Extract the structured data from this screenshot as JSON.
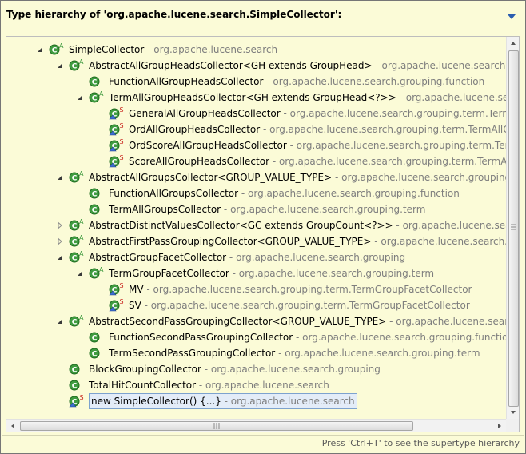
{
  "header": {
    "title": "Type hierarchy of 'org.apache.lucene.search.SimpleCollector':",
    "menu_icon": "triangle-down-icon"
  },
  "tree": {
    "rows": [
      {
        "name": "SimpleCollector",
        "qual": " - org.apache.lucene.search",
        "level": 0,
        "twisty": "expanded",
        "icon": "class-abstract"
      },
      {
        "name": "AbstractAllGroupHeadsCollector<GH extends GroupHead>",
        "qual": " - org.apache.lucene.search.grouping",
        "level": 1,
        "twisty": "expanded",
        "icon": "class-abstract"
      },
      {
        "name": "FunctionAllGroupHeadsCollector",
        "qual": " - org.apache.lucene.search.grouping.function",
        "level": 2,
        "twisty": "none",
        "icon": "class"
      },
      {
        "name": "TermAllGroupHeadsCollector<GH extends GroupHead<?>>",
        "qual": " - org.apache.lucene.search.grouping.term",
        "level": 2,
        "twisty": "expanded",
        "icon": "class-abstract"
      },
      {
        "name": "GeneralAllGroupHeadsCollector",
        "qual": " - org.apache.lucene.search.grouping.term.TermAllGroupHeadsCollector",
        "level": 3,
        "twisty": "none",
        "icon": "class-static-inner"
      },
      {
        "name": "OrdAllGroupHeadsCollector",
        "qual": " - org.apache.lucene.search.grouping.term.TermAllGroupHeadsCollector",
        "level": 3,
        "twisty": "none",
        "icon": "class-static-inner"
      },
      {
        "name": "OrdScoreAllGroupHeadsCollector",
        "qual": " - org.apache.lucene.search.grouping.term.TermAllGroupHeadsCollector",
        "level": 3,
        "twisty": "none",
        "icon": "class-static-inner"
      },
      {
        "name": "ScoreAllGroupHeadsCollector",
        "qual": " - org.apache.lucene.search.grouping.term.TermAllGroupHeadsCollector",
        "level": 3,
        "twisty": "none",
        "icon": "class-static-inner"
      },
      {
        "name": "AbstractAllGroupsCollector<GROUP_VALUE_TYPE>",
        "qual": " - org.apache.lucene.search.grouping",
        "level": 1,
        "twisty": "expanded",
        "icon": "class-abstract"
      },
      {
        "name": "FunctionAllGroupsCollector",
        "qual": " - org.apache.lucene.search.grouping.function",
        "level": 2,
        "twisty": "none",
        "icon": "class"
      },
      {
        "name": "TermAllGroupsCollector",
        "qual": " - org.apache.lucene.search.grouping.term",
        "level": 2,
        "twisty": "none",
        "icon": "class"
      },
      {
        "name": "AbstractDistinctValuesCollector<GC extends GroupCount<?>>",
        "qual": " - org.apache.lucene.search.grouping",
        "level": 1,
        "twisty": "collapsed",
        "icon": "class-abstract"
      },
      {
        "name": "AbstractFirstPassGroupingCollector<GROUP_VALUE_TYPE>",
        "qual": " - org.apache.lucene.search.grouping",
        "level": 1,
        "twisty": "collapsed",
        "icon": "class-abstract"
      },
      {
        "name": "AbstractGroupFacetCollector",
        "qual": " - org.apache.lucene.search.grouping",
        "level": 1,
        "twisty": "expanded",
        "icon": "class-abstract"
      },
      {
        "name": "TermGroupFacetCollector",
        "qual": " - org.apache.lucene.search.grouping.term",
        "level": 2,
        "twisty": "expanded",
        "icon": "class-abstract"
      },
      {
        "name": "MV",
        "qual": " - org.apache.lucene.search.grouping.term.TermGroupFacetCollector",
        "level": 3,
        "twisty": "none",
        "icon": "class-static-inner"
      },
      {
        "name": "SV",
        "qual": " - org.apache.lucene.search.grouping.term.TermGroupFacetCollector",
        "level": 3,
        "twisty": "none",
        "icon": "class-static-inner"
      },
      {
        "name": "AbstractSecondPassGroupingCollector<GROUP_VALUE_TYPE>",
        "qual": " - org.apache.lucene.search.grouping",
        "level": 1,
        "twisty": "expanded",
        "icon": "class-abstract"
      },
      {
        "name": "FunctionSecondPassGroupingCollector",
        "qual": " - org.apache.lucene.search.grouping.function",
        "level": 2,
        "twisty": "none",
        "icon": "class"
      },
      {
        "name": "TermSecondPassGroupingCollector",
        "qual": " - org.apache.lucene.search.grouping.term",
        "level": 2,
        "twisty": "none",
        "icon": "class"
      },
      {
        "name": "BlockGroupingCollector",
        "qual": " - org.apache.lucene.search.grouping",
        "level": 1,
        "twisty": "none",
        "icon": "class"
      },
      {
        "name": "TotalHitCountCollector",
        "qual": " - org.apache.lucene.search",
        "level": 1,
        "twisty": "none",
        "icon": "class"
      },
      {
        "name": "new SimpleCollector() {...}",
        "qual": " - org.apache.lucene.search",
        "level": 1,
        "twisty": "none",
        "icon": "class-static-inner",
        "selected": true
      }
    ]
  },
  "status": {
    "hint": "Press 'Ctrl+T' to see the supertype hierarchy"
  },
  "colors": {
    "background": "#fbfbd7",
    "class_icon": "#3f9b3f",
    "qualifier_text": "#7e7e7e",
    "selection_border": "#7da2ce",
    "static_marker": "#c8201a"
  }
}
